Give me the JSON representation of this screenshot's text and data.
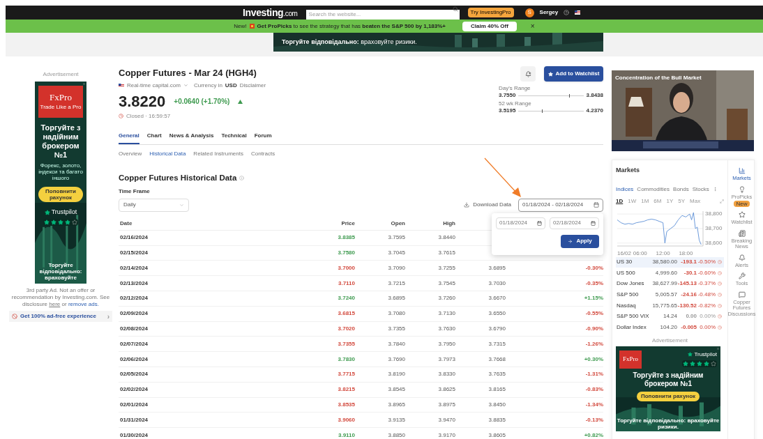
{
  "top_bar": {
    "logo": "Investing",
    "logo_suffix": ".com",
    "search": {
      "placeholder": "Search the website..."
    },
    "pro_button": "Try InvestingPro",
    "user": {
      "initial": "S",
      "name": "Sergey"
    }
  },
  "promo_bar": {
    "prefix": "New!",
    "text": "**Get ProPicks** to see the strategy that has **beaten the S&P 500 by 1,183%+**",
    "button": "Claim 40% Off",
    "close": "×"
  },
  "top_banner": {
    "text": "**Торгуйте відповідально:** враховуйте ризики."
  },
  "left_ad": {
    "label": "Advertisement",
    "brand": "FxPro",
    "tagline": "Trade Like a Pro",
    "headline": "Торгуйте з надійним брокером №1",
    "body": "Форекс, золото, індекси та багато іншого",
    "button": "Поповнити рахунок",
    "trust": "Trustpilot",
    "stars": 4,
    "footer": "Торгуйте відповідально: враховуйте",
    "disclaimer": "3rd party Ad. Not an offer or recommendation by Investing.com. See disclosure",
    "disclaimer_link1": "here",
    "disclaimer_or": "or",
    "disclaimer_link2": "remove ads.",
    "ad_free": "Get 100% ad-free experience",
    "ad_free_arrow": "›"
  },
  "instrument": {
    "title": "Copper Futures - Mar 24 (HGH4)",
    "source": "Real-time capital.com",
    "currency_label": "Currency in",
    "currency": "USD",
    "disclaimer": "Disclaimer",
    "price": "3.8220",
    "change": "+0.0640 (+1.70%)",
    "color": "#3e9a4f",
    "status": "Closed · 16:59:57",
    "watch_button": "Add to Watchlist",
    "ranges": [
      {
        "label": "Day's Range",
        "low": "3.7550",
        "high": "3.8438",
        "level": 0.78
      },
      {
        "label": "52 wk Range",
        "low": "3.5195",
        "high": "4.2370",
        "level": 0.36
      }
    ]
  },
  "tabs": [
    {
      "label": "General",
      "selected": true
    },
    {
      "label": "Chart",
      "selected": false
    },
    {
      "label": "News & Analysis",
      "selected": false
    },
    {
      "label": "Technical",
      "selected": false
    },
    {
      "label": "Forum",
      "selected": false
    }
  ],
  "subtabs": [
    {
      "label": "Overview",
      "selected": false
    },
    {
      "label": "Historical Data",
      "selected": true
    },
    {
      "label": "Related Instruments",
      "selected": false
    },
    {
      "label": "Contracts",
      "selected": false
    }
  ],
  "historical": {
    "title": "Copper Futures Historical Data",
    "timeframe_label": "Time Frame",
    "timeframe": "Daily",
    "download": "Download Data",
    "date_range": "01/18/2024 - 02/18/2024",
    "popup": {
      "start": "01/18/2024",
      "end": "02/18/2024",
      "button": "Apply"
    },
    "columns": [
      "Date",
      "Price",
      "Open",
      "High"
    ],
    "rows": [
      {
        "date": "02/16/2024",
        "price": "3.8385",
        "open": "3.7595",
        "high": "3.8440",
        "color": "#3e9a4f"
      },
      {
        "date": "02/15/2024",
        "price": "3.7580",
        "open": "3.7045",
        "high": "3.7615",
        "color": "#3e9a4f"
      },
      {
        "date": "02/14/2024",
        "price": "3.7000",
        "open": "3.7090",
        "high": "3.7255",
        "low": "3.6895",
        "change": "-0.30%",
        "color": "#d2483c"
      },
      {
        "date": "02/13/2024",
        "price": "3.7110",
        "open": "3.7215",
        "high": "3.7545",
        "low": "3.7030",
        "change": "-0.35%",
        "color": "#d2483c"
      },
      {
        "date": "02/12/2024",
        "price": "3.7240",
        "open": "3.6895",
        "high": "3.7260",
        "low": "3.6670",
        "change": "+1.15%",
        "color": "#3e9a4f"
      },
      {
        "date": "02/09/2024",
        "price": "3.6815",
        "open": "3.7080",
        "high": "3.7130",
        "low": "3.6550",
        "change": "-0.55%",
        "color": "#d2483c"
      },
      {
        "date": "02/08/2024",
        "price": "3.7020",
        "open": "3.7355",
        "high": "3.7630",
        "low": "3.6790",
        "change": "-0.90%",
        "color": "#d2483c"
      },
      {
        "date": "02/07/2024",
        "price": "3.7355",
        "open": "3.7840",
        "high": "3.7950",
        "low": "3.7315",
        "change": "-1.26%",
        "color": "#d2483c"
      },
      {
        "date": "02/06/2024",
        "price": "3.7830",
        "open": "3.7690",
        "high": "3.7973",
        "low": "3.7668",
        "change": "+0.30%",
        "color": "#3e9a4f"
      },
      {
        "date": "02/05/2024",
        "price": "3.7715",
        "open": "3.8190",
        "high": "3.8330",
        "low": "3.7635",
        "change": "-1.31%",
        "color": "#d2483c"
      },
      {
        "date": "02/02/2024",
        "price": "3.8215",
        "open": "3.8545",
        "high": "3.8625",
        "low": "3.8165",
        "change": "-0.83%",
        "color": "#d2483c"
      },
      {
        "date": "02/01/2024",
        "price": "3.8535",
        "open": "3.8965",
        "high": "3.8975",
        "low": "3.8450",
        "change": "-1.34%",
        "color": "#d2483c"
      },
      {
        "date": "01/31/2024",
        "price": "3.9060",
        "open": "3.9135",
        "high": "3.9470",
        "low": "3.8835",
        "change": "-0.13%",
        "color": "#d2483c"
      },
      {
        "date": "01/30/2024",
        "price": "3.9110",
        "open": "3.8850",
        "high": "3.9170",
        "low": "3.8605",
        "change": "+0.82%",
        "color": "#3e9a4f"
      }
    ]
  },
  "video": {
    "title": "Concentration of the Bull Market"
  },
  "markets": {
    "title": "Markets",
    "tabs": [
      {
        "label": "Indices",
        "selected": true
      },
      {
        "label": "Commodities",
        "selected": false
      },
      {
        "label": "Bonds",
        "selected": false
      },
      {
        "label": "Stocks",
        "selected": false
      }
    ],
    "periods": [
      {
        "label": "1D",
        "selected": true
      },
      {
        "label": "1W",
        "selected": false
      },
      {
        "label": "1M",
        "selected": false
      },
      {
        "label": "6M",
        "selected": false
      },
      {
        "label": "1Y",
        "selected": false
      },
      {
        "label": "5Y",
        "selected": false
      },
      {
        "label": "Max",
        "selected": false
      }
    ],
    "chart_data": {
      "type": "line",
      "grid": true,
      "x": [
        0,
        1,
        2,
        3,
        4,
        5,
        6,
        7,
        8,
        9,
        10,
        11,
        12,
        12.5,
        13,
        14,
        15,
        16,
        17,
        18,
        19,
        19.5,
        20,
        20.5,
        21,
        21.5,
        22
      ],
      "series": [
        {
          "color": "#5b8fd6",
          "values": [
            38760,
            38740,
            38730,
            38735,
            38730,
            38740,
            38745,
            38750,
            38760,
            38765,
            38760,
            38750,
            38740,
            38600,
            38680,
            38700,
            38720,
            38760,
            38790,
            38780,
            38800,
            38760,
            38810,
            38700,
            38710,
            38620,
            38590
          ]
        }
      ],
      "xlim": [
        0,
        22.5
      ],
      "ylim": [
        38580,
        38820
      ],
      "xticks": [
        {
          "value": 0,
          "label": "16/02"
        },
        {
          "value": 6,
          "label": "06:00"
        },
        {
          "value": 12,
          "label": "12:00"
        },
        {
          "value": 18,
          "label": "18:00"
        }
      ],
      "yticks": [
        {
          "value": 38800,
          "label": "38,800"
        },
        {
          "value": 38700,
          "label": "38,700"
        },
        {
          "value": 38600,
          "label": "38,600"
        }
      ]
    },
    "rows": [
      {
        "name": "US 30",
        "last": "38,580.00",
        "chg": "-193.1",
        "pct": "-0.50%",
        "color": "#d2483c",
        "selected": true
      },
      {
        "name": "US 500",
        "last": "4,999.60",
        "chg": "-30.1",
        "pct": "-0.60%",
        "color": "#d2483c",
        "selected": false
      },
      {
        "name": "Dow Jones",
        "last": "38,627.99",
        "chg": "-145.13",
        "pct": "-0.37%",
        "color": "#d2483c",
        "selected": false
      },
      {
        "name": "S&P 500",
        "last": "5,005.57",
        "chg": "-24.16",
        "pct": "-0.48%",
        "color": "#d2483c",
        "selected": false
      },
      {
        "name": "Nasdaq",
        "last": "15,775.65",
        "chg": "-130.52",
        "pct": "-0.82%",
        "color": "#d2483c",
        "selected": false
      },
      {
        "name": "S&P 500 VIX",
        "last": "14.24",
        "chg": "0.00",
        "pct": "0.00%",
        "color": "#999999",
        "selected": false
      },
      {
        "name": "Dollar Index",
        "last": "104.20",
        "chg": "-0.005",
        "pct": "0.00%",
        "color": "#d2483c",
        "selected": false
      }
    ]
  },
  "side_nav": [
    {
      "kind": "markets",
      "label": "Markets",
      "selected": true
    },
    {
      "kind": "propicks",
      "label": "ProPicks",
      "badge": "New",
      "selected": false
    },
    {
      "kind": "watchlist",
      "label": "Watchlist",
      "selected": false
    },
    {
      "kind": "news",
      "label": "Breaking News",
      "selected": false
    },
    {
      "kind": "alerts",
      "label": "Alerts",
      "selected": false
    },
    {
      "kind": "tools",
      "label": "Tools",
      "selected": false
    },
    {
      "kind": "discussions",
      "label": "Copper Futures Discussions",
      "selected": false
    }
  ],
  "right_ad": {
    "label": "Advertisement",
    "brand": "FxPro",
    "trust": "Trustpilot",
    "stars": 4,
    "headline": "Торгуйте з надійним брокером №1",
    "button": "Поповнити рахунок",
    "footer": "Торгуйте відповідально: враховуйте ризики."
  }
}
